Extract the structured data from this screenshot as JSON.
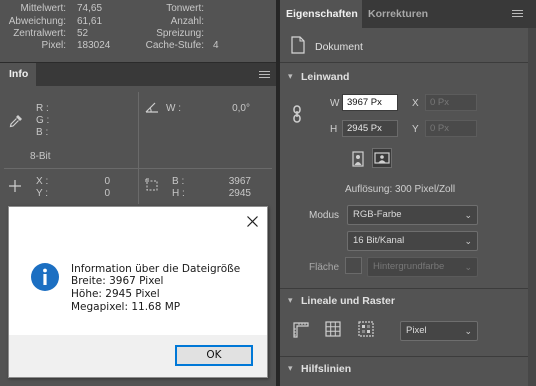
{
  "histogram_stats": {
    "left": [
      {
        "label": "Mittelwert:",
        "value": "74,65"
      },
      {
        "label": "Abweichung:",
        "value": "61,61"
      },
      {
        "label": "Zentralwert:",
        "value": "52"
      },
      {
        "label": "Pixel:",
        "value": "183024"
      }
    ],
    "right": [
      {
        "label": "Tonwert:",
        "value": ""
      },
      {
        "label": "Anzahl:",
        "value": ""
      },
      {
        "label": "Spreizung:",
        "value": ""
      },
      {
        "label": "Cache-Stufe:",
        "value": "4"
      }
    ]
  },
  "info_panel": {
    "tab": "Info",
    "color_labels": [
      "R :",
      "G :",
      "B :"
    ],
    "angle_label": "W :",
    "angle_value": "0,0°",
    "bit_depth": "8-Bit",
    "pos_labels": [
      "X :",
      "Y :"
    ],
    "pos_values": [
      "0",
      "0"
    ],
    "size_labels": [
      "B :",
      "H :"
    ],
    "size_values": [
      "3967",
      "2945"
    ]
  },
  "dialog": {
    "title_text": "Information über die Dateigröße",
    "lines": [
      "Breite: 3967 Pixel",
      "Höhe: 2945 Pixel",
      "Megapixel: 11.68 MP"
    ],
    "ok_label": "OK"
  },
  "properties": {
    "tabs": [
      "Eigenschaften",
      "Korrekturen"
    ],
    "doc_label": "Dokument",
    "canvas_section": "Leinwand",
    "w_label": "W",
    "w_value": "3967 Px",
    "h_label": "H",
    "h_value": "2945 Px",
    "x_label": "X",
    "x_placeholder": "0 Px",
    "y_label": "Y",
    "y_placeholder": "0 Px",
    "resolution": "Auflösung: 300 Pixel/Zoll",
    "mode_label": "Modus",
    "mode_value": "RGB-Farbe",
    "depth_value": "16 Bit/Kanal",
    "fill_label": "Fläche",
    "fill_value": "Hintergrundfarbe",
    "rulers_section": "Lineale und Raster",
    "units_value": "Pixel",
    "guides_section": "Hilfslinien"
  }
}
